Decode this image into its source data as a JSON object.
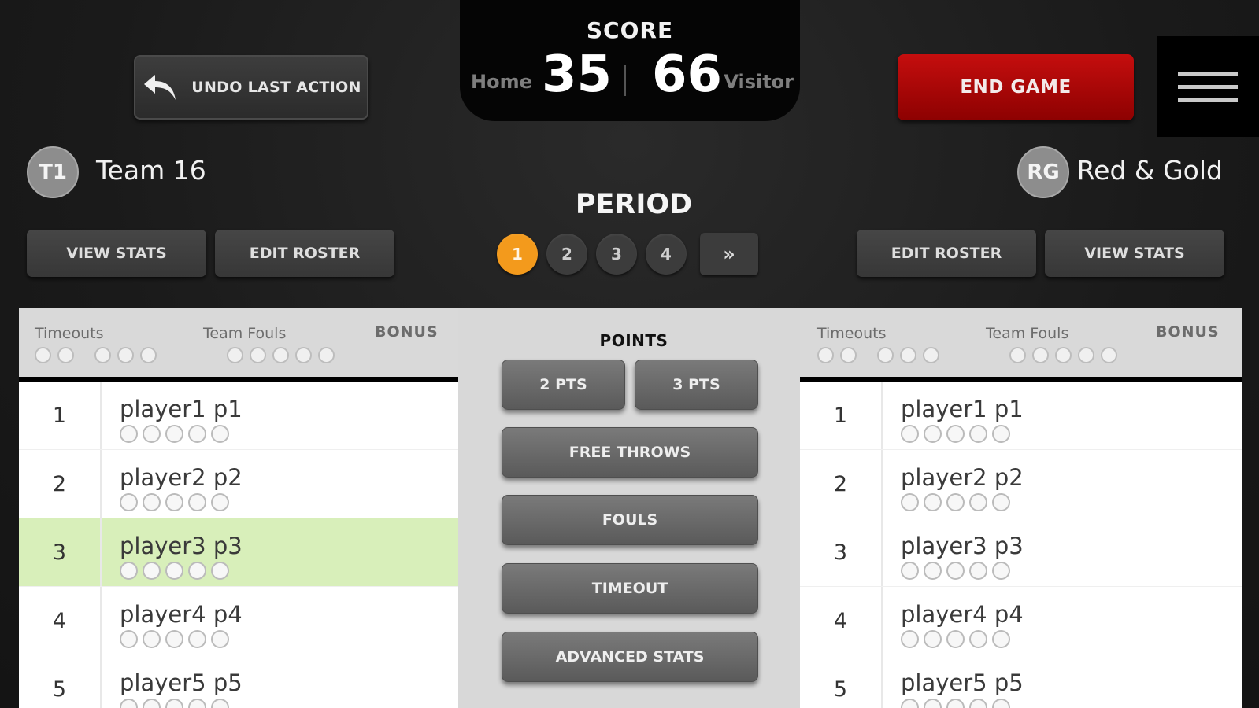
{
  "header": {
    "undo_label": "UNDO LAST ACTION",
    "end_game_label": "END GAME"
  },
  "score": {
    "title": "SCORE",
    "home_label": "Home",
    "home_value": "35",
    "visitor_value": "66",
    "visitor_label": "Visitor"
  },
  "teams": {
    "home": {
      "initials": "T1",
      "name": "Team 16"
    },
    "visitor": {
      "initials": "RG",
      "name": "Red & Gold"
    }
  },
  "period": {
    "title": "PERIOD",
    "options": [
      "1",
      "2",
      "3",
      "4"
    ],
    "active": "1",
    "next_label": "»"
  },
  "team_buttons": {
    "view_stats": "VIEW STATS",
    "edit_roster": "EDIT ROSTER"
  },
  "panel_labels": {
    "timeouts": "Timeouts",
    "team_fouls": "Team Fouls",
    "bonus": "BONUS"
  },
  "actions": {
    "points_title": "POINTS",
    "two_pts": "2 PTS",
    "three_pts": "3 PTS",
    "free_throws": "FREE THROWS",
    "fouls": "FOULS",
    "timeout": "TIMEOUT",
    "advanced_stats": "ADVANCED STATS"
  },
  "home_players": [
    {
      "number": "1",
      "name": "player1 p1"
    },
    {
      "number": "2",
      "name": "player2 p2"
    },
    {
      "number": "3",
      "name": "player3 p3",
      "selected": true
    },
    {
      "number": "4",
      "name": "player4 p4"
    },
    {
      "number": "5",
      "name": "player5 p5"
    }
  ],
  "visitor_players": [
    {
      "number": "1",
      "name": "player1 p1"
    },
    {
      "number": "2",
      "name": "player2 p2"
    },
    {
      "number": "3",
      "name": "player3 p3"
    },
    {
      "number": "4",
      "name": "player4 p4"
    },
    {
      "number": "5",
      "name": "player5 p5"
    }
  ],
  "colors": {
    "accent_period": "#f39a1c",
    "end_game": "#b00808",
    "selected_row": "#d8efba"
  }
}
